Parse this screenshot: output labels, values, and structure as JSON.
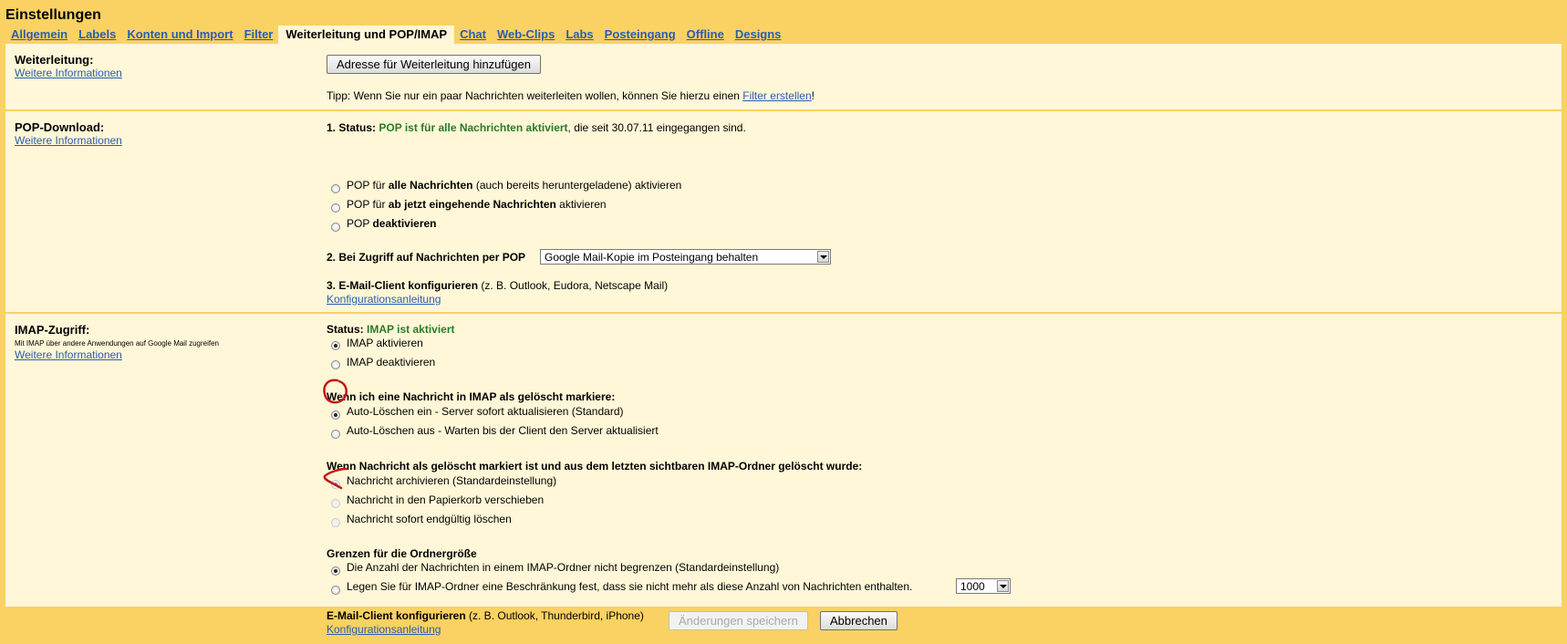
{
  "page_title": "Einstellungen",
  "tabs": [
    {
      "label": "Allgemein"
    },
    {
      "label": "Labels"
    },
    {
      "label": "Konten und Import"
    },
    {
      "label": "Filter"
    },
    {
      "label": "Weiterleitung und POP/IMAP"
    },
    {
      "label": "Chat"
    },
    {
      "label": "Web-Clips"
    },
    {
      "label": "Labs"
    },
    {
      "label": "Posteingang"
    },
    {
      "label": "Offline"
    },
    {
      "label": "Designs"
    }
  ],
  "active_tab": "Weiterleitung und POP/IMAP",
  "forwarding": {
    "title": "Weiterleitung:",
    "more_info": "Weitere Informationen",
    "add_button": "Adresse für Weiterleitung hinzufügen",
    "tip_prefix": "Tipp: Wenn Sie nur ein paar Nachrichten weiterleiten wollen, können Sie hierzu einen ",
    "tip_link": "Filter erstellen",
    "tip_suffix": "!"
  },
  "pop": {
    "title": "POP-Download:",
    "more_info": "Weitere Informationen",
    "status_prefix": "1. Status: ",
    "status_value": "POP ist für alle Nachrichten aktiviert",
    "status_suffix": ", die seit 30.07.11 eingegangen sind.",
    "options": [
      {
        "pre": "POP für ",
        "bold": "alle Nachrichten",
        "post": " (auch bereits heruntergeladene) aktivieren",
        "checked": false
      },
      {
        "pre": "POP für ",
        "bold": "ab jetzt eingehende Nachrichten",
        "post": " aktivieren",
        "checked": false
      },
      {
        "pre": "POP ",
        "bold": "deaktivieren",
        "post": "",
        "checked": false
      }
    ],
    "access_label": "2. Bei Zugriff auf Nachrichten per POP",
    "access_value": "Google Mail-Kopie im Posteingang behalten",
    "client_bold": "3. E-Mail-Client konfigurieren",
    "client_rest": " (z. B. Outlook, Eudora, Netscape Mail)",
    "client_link": "Konfigurationsanleitung"
  },
  "imap": {
    "title": "IMAP-Zugriff:",
    "subtitle": "Mit IMAP über andere Anwendungen auf Google Mail zugreifen",
    "more_info": "Weitere Informationen",
    "status_prefix": "Status: ",
    "status_value": "IMAP ist aktiviert",
    "enable_options": [
      {
        "label": "IMAP aktivieren",
        "checked": true
      },
      {
        "label": "IMAP deaktivieren",
        "checked": false
      }
    ],
    "delete_heading": "Wenn ich eine Nachricht in IMAP als gelöscht markiere:",
    "delete_options": [
      {
        "label": "Auto-Löschen ein - Server sofort aktualisieren (Standard)",
        "checked": true
      },
      {
        "label": "Auto-Löschen aus - Warten bis der Client den Server aktualisiert",
        "checked": false
      }
    ],
    "expunge_heading": "Wenn Nachricht als gelöscht markiert ist und aus dem letzten sichtbaren IMAP-Ordner gelöscht wurde:",
    "expunge_options": [
      {
        "label": "Nachricht archivieren (Standardeinstellung)",
        "checked": true,
        "disabled": true
      },
      {
        "label": "Nachricht in den Papierkorb verschieben",
        "checked": false,
        "disabled": true
      },
      {
        "label": "Nachricht sofort endgültig löschen",
        "checked": false,
        "disabled": true
      }
    ],
    "folder_heading": "Grenzen für die Ordnergröße",
    "folder_options": [
      {
        "label": "Die Anzahl der Nachrichten in einem IMAP-Ordner nicht begrenzen (Standardeinstellung)",
        "checked": true
      },
      {
        "label": "Legen Sie für IMAP-Ordner eine Beschränkung fest, dass sie nicht mehr als diese Anzahl von Nachrichten enthalten.",
        "checked": false
      }
    ],
    "folder_limit_value": "1000",
    "client_bold": "E-Mail-Client konfigurieren",
    "client_rest": " (z. B. Outlook, Thunderbird, iPhone)",
    "client_link": "Konfigurationsanleitung"
  },
  "footer": {
    "save_button": "Änderungen speichern",
    "cancel_button": "Abbrechen"
  },
  "colors": {
    "frame": "#fad163",
    "panel": "#fff7d7",
    "link": "#2a5db0",
    "status_green": "#2b7a2b",
    "annotation_red": "#c4161c"
  }
}
